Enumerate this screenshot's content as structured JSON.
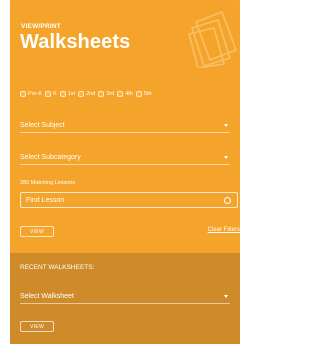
{
  "header": {
    "eyebrow": "VIEW/PRINT",
    "title": "Walksheets"
  },
  "grades": [
    {
      "label": "Pre-K",
      "checked": false
    },
    {
      "label": "K",
      "checked": false
    },
    {
      "label": "1st",
      "checked": false
    },
    {
      "label": "2nd",
      "checked": false
    },
    {
      "label": "3rd",
      "checked": false
    },
    {
      "label": "4th",
      "checked": false
    },
    {
      "label": "5th",
      "checked": false
    }
  ],
  "subject_select": {
    "value": "Select Subject"
  },
  "subcategory_select": {
    "value": "Select Subcategory"
  },
  "matching_count": "280 Matching Lessons",
  "find_lesson": {
    "placeholder": "Find Lesson"
  },
  "view_button": "VIEW",
  "clear_filters": "Clear Filters",
  "recent": {
    "label": "RECENT WALKSHEETS:",
    "walksheet_select": {
      "value": "Select Walksheet"
    },
    "view_button": "VIEW"
  },
  "colors": {
    "panel": "#f5a42b",
    "recent_panel": "#cf8b2a",
    "text": "#ffffff"
  }
}
